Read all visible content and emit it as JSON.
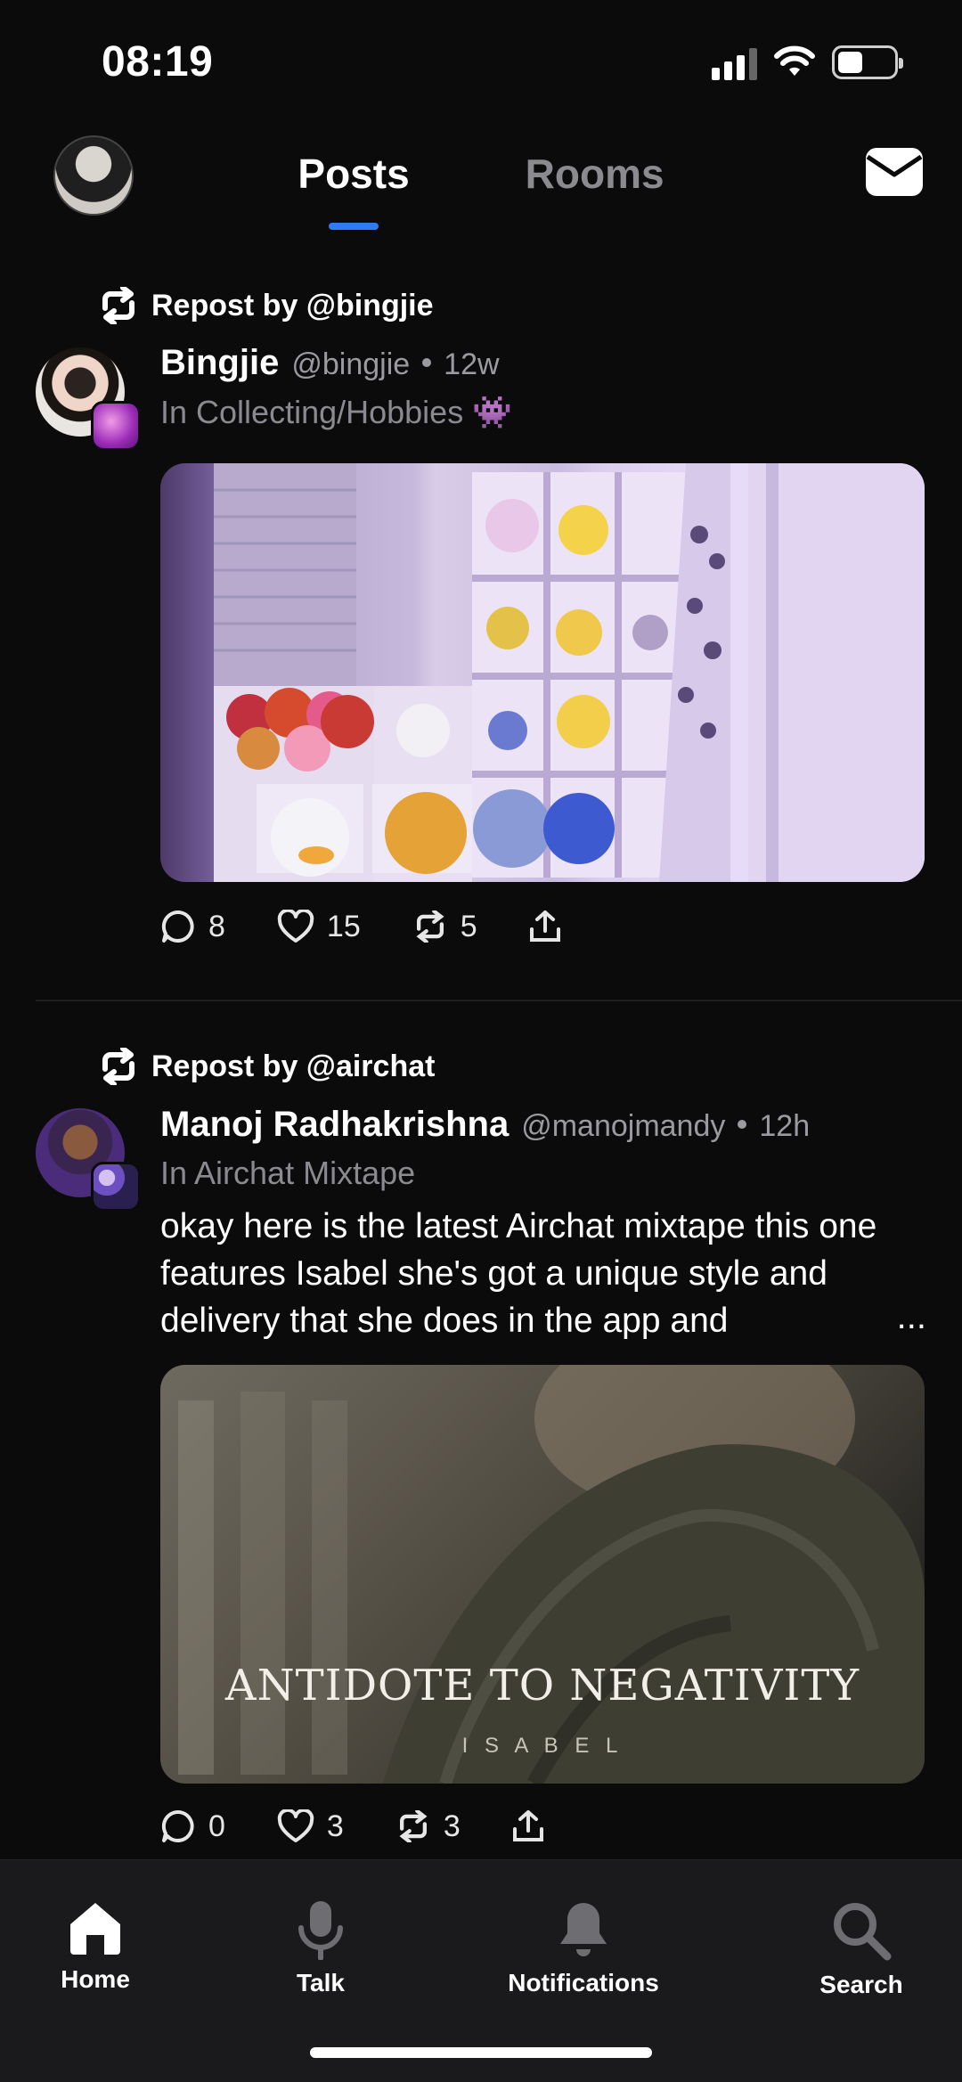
{
  "status_bar": {
    "time": "08:19",
    "battery_level": 0.45
  },
  "header": {
    "tabs": [
      {
        "label": "Posts",
        "active": true
      },
      {
        "label": "Rooms",
        "active": false
      }
    ],
    "mail_icon": "envelope-icon",
    "accent_color": "#2f7bf6"
  },
  "posts": [
    {
      "repost_label": "Repost by @bingjie",
      "author_name": "Bingjie",
      "author_handle": "@bingjie",
      "time": "12w",
      "room": "In Collecting/Hobbies 👾",
      "text": "",
      "media_caption_title": "",
      "media_caption_sub": "",
      "counts": {
        "replies": "8",
        "likes": "15",
        "reposts": "5"
      }
    },
    {
      "repost_label": "Repost by @airchat",
      "author_name": "Manoj Radhakrishna",
      "author_handle": "@manojmandy",
      "time": "12h",
      "room": "In Airchat Mixtape",
      "text": "okay here is the latest Airchat mixtape this one features Isabel she's got a unique style and delivery that she does in the app and",
      "more_label": "...",
      "media_caption_title": "ANTIDOTE TO NEGATIVITY",
      "media_caption_sub": "I S A B E L",
      "counts": {
        "replies": "0",
        "likes": "3",
        "reposts": "3"
      }
    }
  ],
  "bottom_nav": [
    {
      "label": "Home",
      "icon": "home-icon",
      "active": true
    },
    {
      "label": "Talk",
      "icon": "microphone-icon",
      "active": false
    },
    {
      "label": "Notifications",
      "icon": "bell-icon",
      "active": false
    },
    {
      "label": "Search",
      "icon": "search-icon",
      "active": false
    }
  ]
}
